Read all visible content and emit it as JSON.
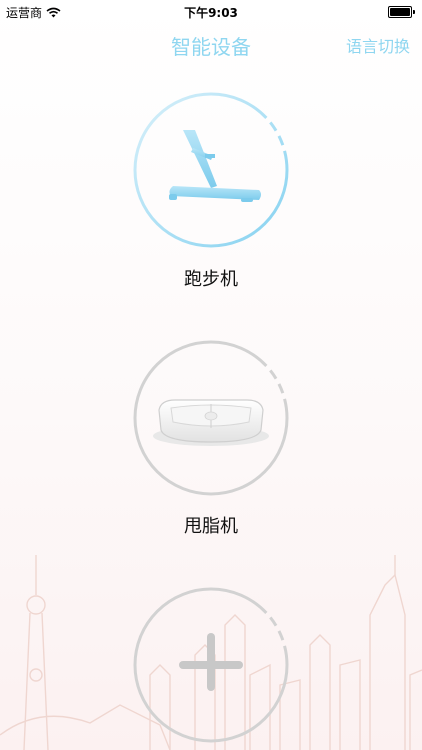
{
  "status_bar": {
    "carrier": "运营商",
    "time": "下午9:03"
  },
  "nav": {
    "title": "智能设备",
    "lang_switch_label": "语言切换"
  },
  "devices": [
    {
      "name": "跑步机",
      "icon": "treadmill-icon",
      "ring_color": "#8fd6f0"
    },
    {
      "name": "甩脂机",
      "icon": "vibration-plate-icon",
      "ring_color": "#d0d0d0"
    }
  ],
  "add_device": {
    "icon": "plus-icon"
  },
  "colors": {
    "accent": "#8fd6f0",
    "skyline": "#f0d9d4"
  }
}
